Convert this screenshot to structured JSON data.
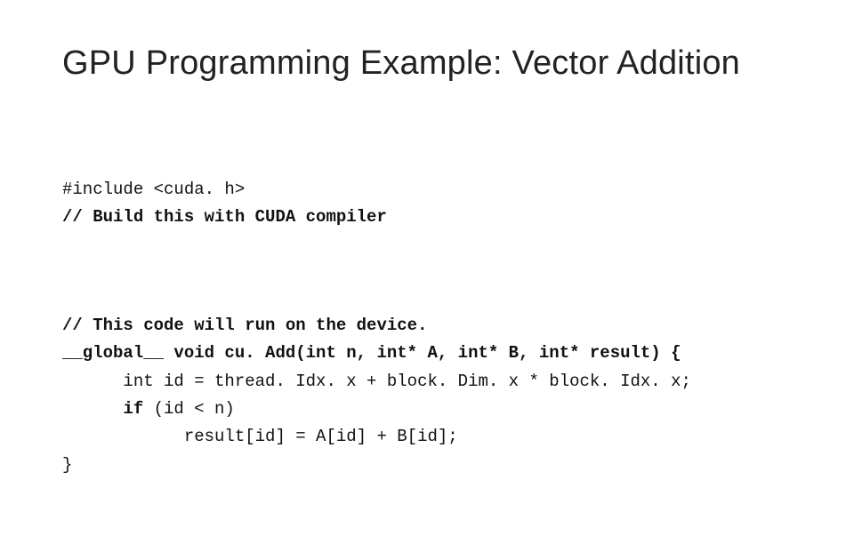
{
  "title": "GPU Programming Example: Vector Addition",
  "code": {
    "b1": {
      "l1": "#include <cuda. h>",
      "l2": "// Build this with CUDA compiler"
    },
    "b2": {
      "l1": "// This code will run on the device.",
      "l2a": "__global__ void cu. Add(int n, int* A, int* B, int* result) {",
      "l3a": "      int id = thread. Idx. x + block. Dim. x * block. Idx. x;",
      "l4a": "      if",
      "l4b": " (id < n)",
      "l5": "            result[id] = A[id] + B[id];",
      "l6": "}"
    }
  }
}
